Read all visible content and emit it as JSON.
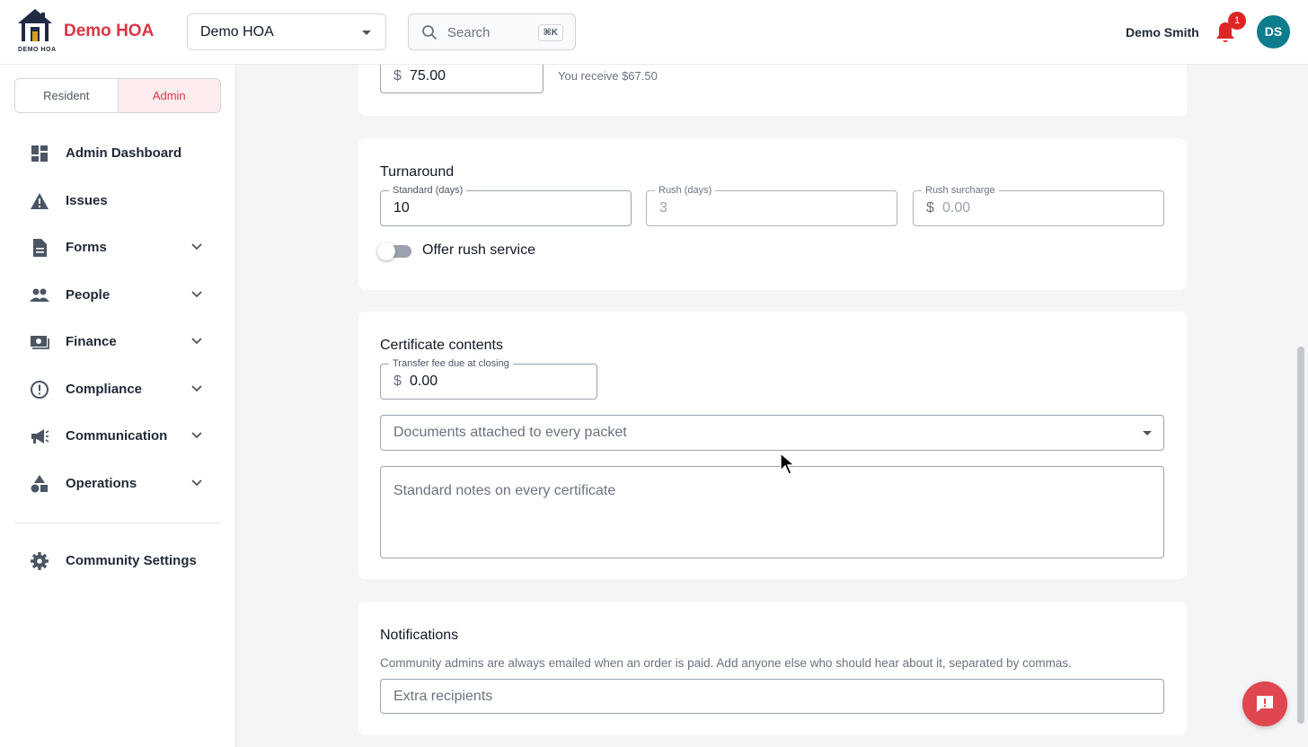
{
  "header": {
    "brand": "Demo HOA",
    "logo_caption": "DEMO HOA",
    "community_select": "Demo HOA",
    "search_placeholder": "Search",
    "search_shortcut": "⌘K",
    "user_name": "Demo Smith",
    "notification_count": "1",
    "avatar_initials": "DS"
  },
  "sidebar": {
    "roles": {
      "resident": "Resident",
      "admin": "Admin",
      "active": "Admin"
    },
    "items": [
      {
        "label": "Admin Dashboard",
        "icon": "dashboard-icon",
        "expandable": false
      },
      {
        "label": "Issues",
        "icon": "warning-icon",
        "expandable": false
      },
      {
        "label": "Forms",
        "icon": "document-icon",
        "expandable": true
      },
      {
        "label": "People",
        "icon": "people-icon",
        "expandable": true
      },
      {
        "label": "Finance",
        "icon": "money-icon",
        "expandable": true
      },
      {
        "label": "Compliance",
        "icon": "alert-circle-icon",
        "expandable": true
      },
      {
        "label": "Communication",
        "icon": "megaphone-icon",
        "expandable": true
      },
      {
        "label": "Operations",
        "icon": "shapes-icon",
        "expandable": true
      }
    ],
    "settings_label": "Community Settings"
  },
  "main": {
    "price": {
      "currency": "$",
      "value": "75.00",
      "receive_note": "You receive $67.50"
    },
    "turnaround": {
      "title": "Turnaround",
      "standard_label": "Standard (days)",
      "standard_value": "10",
      "rush_label": "Rush (days)",
      "rush_value": "3",
      "surcharge_label": "Rush surcharge",
      "surcharge_currency": "$",
      "surcharge_value": "0.00",
      "rush_toggle_label": "Offer rush service",
      "rush_enabled": false
    },
    "certificate": {
      "title": "Certificate contents",
      "transfer_fee_label": "Transfer fee due at closing",
      "transfer_fee_currency": "$",
      "transfer_fee_value": "0.00",
      "documents_placeholder": "Documents attached to every packet",
      "notes_placeholder": "Standard notes on every certificate"
    },
    "notifications": {
      "title": "Notifications",
      "description": "Community admins are always emailed when an order is paid. Add anyone else who should hear about it, separated by commas.",
      "recipients_placeholder": "Extra recipients"
    }
  },
  "colors": {
    "brand": "#dc3545",
    "avatar": "#0d7c8c",
    "badge": "#dc2626",
    "chat_button": "#e0464f",
    "nav_icon": "#4b5563"
  }
}
